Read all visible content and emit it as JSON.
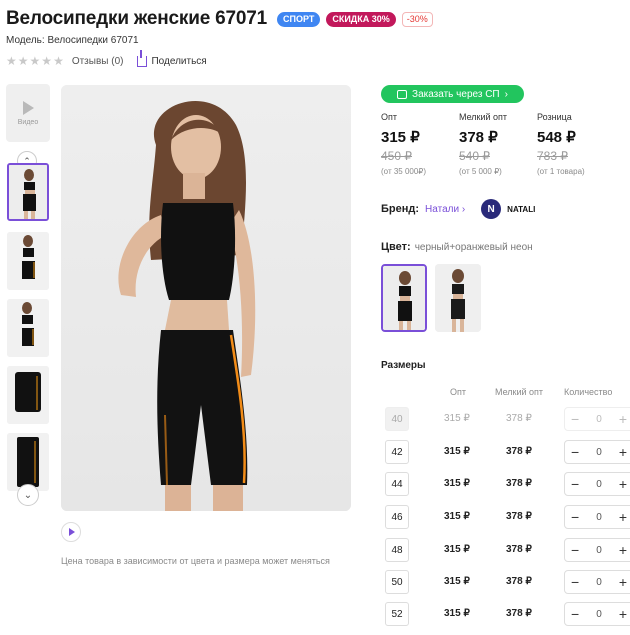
{
  "product": {
    "title": "Велосипедки женские 67071",
    "badges": {
      "sport": "СПОРТ",
      "sale": "СКИДКА 30%",
      "pct": "-30%"
    },
    "model": "Модель: Велосипедки 67071",
    "reviews": "Отзывы (0)",
    "share": "Поделиться"
  },
  "gallery": {
    "video_label": "Видео",
    "note": "Цена товара в зависимости от цвета и размера может меняться"
  },
  "order_button": "Заказать через СП",
  "prices": [
    {
      "label": "Опт",
      "current": "315 ₽",
      "old": "450 ₽",
      "cond": "(от 35 000₽)"
    },
    {
      "label": "Мелкий опт",
      "current": "378 ₽",
      "old": "540 ₽",
      "cond": "(от 5 000 ₽)"
    },
    {
      "label": "Розница",
      "current": "548 ₽",
      "old": "783 ₽",
      "cond": "(от 1 товара)"
    }
  ],
  "brand": {
    "label": "Бренд:",
    "value": "Натали",
    "logo_letter": "N",
    "logo_text": "NATALI"
  },
  "color": {
    "label": "Цвет:",
    "value": "черный+оранжевый неон"
  },
  "sizes": {
    "title": "Размеры",
    "headers": {
      "opt": "Опт",
      "small": "Мелкий опт",
      "qty": "Количество"
    },
    "rows": [
      {
        "size": "40",
        "opt": "315 ₽",
        "small": "378 ₽",
        "qty": "0",
        "available": false
      },
      {
        "size": "42",
        "opt": "315 ₽",
        "small": "378 ₽",
        "qty": "0",
        "available": true
      },
      {
        "size": "44",
        "opt": "315 ₽",
        "small": "378 ₽",
        "qty": "0",
        "available": true
      },
      {
        "size": "46",
        "opt": "315 ₽",
        "small": "378 ₽",
        "qty": "0",
        "available": true
      },
      {
        "size": "48",
        "opt": "315 ₽",
        "small": "378 ₽",
        "qty": "0",
        "available": true
      },
      {
        "size": "50",
        "opt": "315 ₽",
        "small": "378 ₽",
        "qty": "0",
        "available": true
      },
      {
        "size": "52",
        "opt": "315 ₽",
        "small": "378 ₽",
        "qty": "0",
        "available": true
      }
    ]
  },
  "colors": {
    "accent": "#7a4fd8",
    "green": "#22c55e",
    "sport": "#3f86f2",
    "sale": "#c2185b"
  }
}
